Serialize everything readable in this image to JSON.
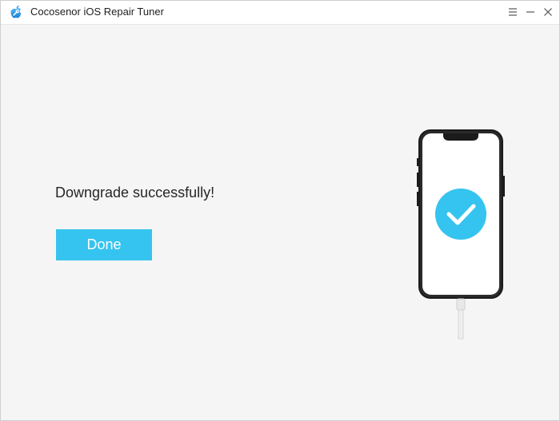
{
  "window": {
    "title": "Cocosenor iOS Repair Tuner"
  },
  "titlebar": {
    "logo_icon": "apple-wrench-logo-icon",
    "menu_icon": "hamburger-menu-icon",
    "minimize_icon": "minimize-icon",
    "close_icon": "close-icon"
  },
  "main": {
    "status_message": "Downgrade successfully!",
    "done_button_label": "Done",
    "illustration": "phone-with-checkmark-icon"
  },
  "colors": {
    "accent": "#35c4ef",
    "background": "#f5f5f5",
    "titlebar": "#ffffff",
    "text": "#262626"
  }
}
